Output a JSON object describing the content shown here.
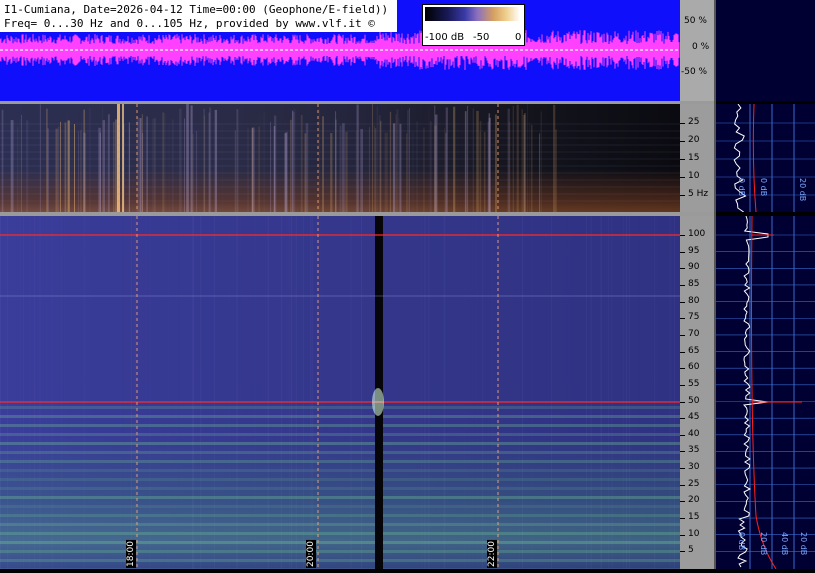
{
  "header": {
    "line1": "I1-Cumiana, Date=2026-04-12 Time=00:00 (Geophone/E-field))",
    "line2": "Freq= 0...30 Hz and 0...105 Hz, provided by www.vlf.it ©"
  },
  "colorbar": {
    "label_min": "-100 dB",
    "label_mid": "-50",
    "label_max": "0"
  },
  "waveform_scale": {
    "labels": [
      "50 %",
      "0 %",
      "-50 %"
    ],
    "colors": {
      "background": "#0f0ffb",
      "trace": "#ff40ff"
    }
  },
  "geophone_scale": {
    "labels": [
      "25",
      "20",
      "15",
      "10",
      "5 Hz"
    ]
  },
  "efield_scale": {
    "labels": [
      "100",
      "95",
      "90",
      "85",
      "80",
      "75",
      "70",
      "65",
      "60",
      "55",
      "50",
      "45",
      "40",
      "35",
      "30",
      "25",
      "20",
      "15",
      "10",
      "5"
    ]
  },
  "time_axis": {
    "labels": [
      "18:00",
      "20:00",
      "22:00"
    ]
  },
  "side_panel": {
    "top_labels": [
      "0 dB",
      "0 dB",
      "20 dB"
    ],
    "bottom_labels": [
      "0 dB",
      "20 dB",
      "40 dB",
      "20 dB"
    ],
    "colors": {
      "background": "#000033",
      "grid": "#3a6acc",
      "trace": "#ffffff",
      "curve": "#ff2020"
    }
  },
  "lines": {
    "colors": {
      "hum_line": "#ff2a2a",
      "time_marker": "#ffb080"
    }
  }
}
